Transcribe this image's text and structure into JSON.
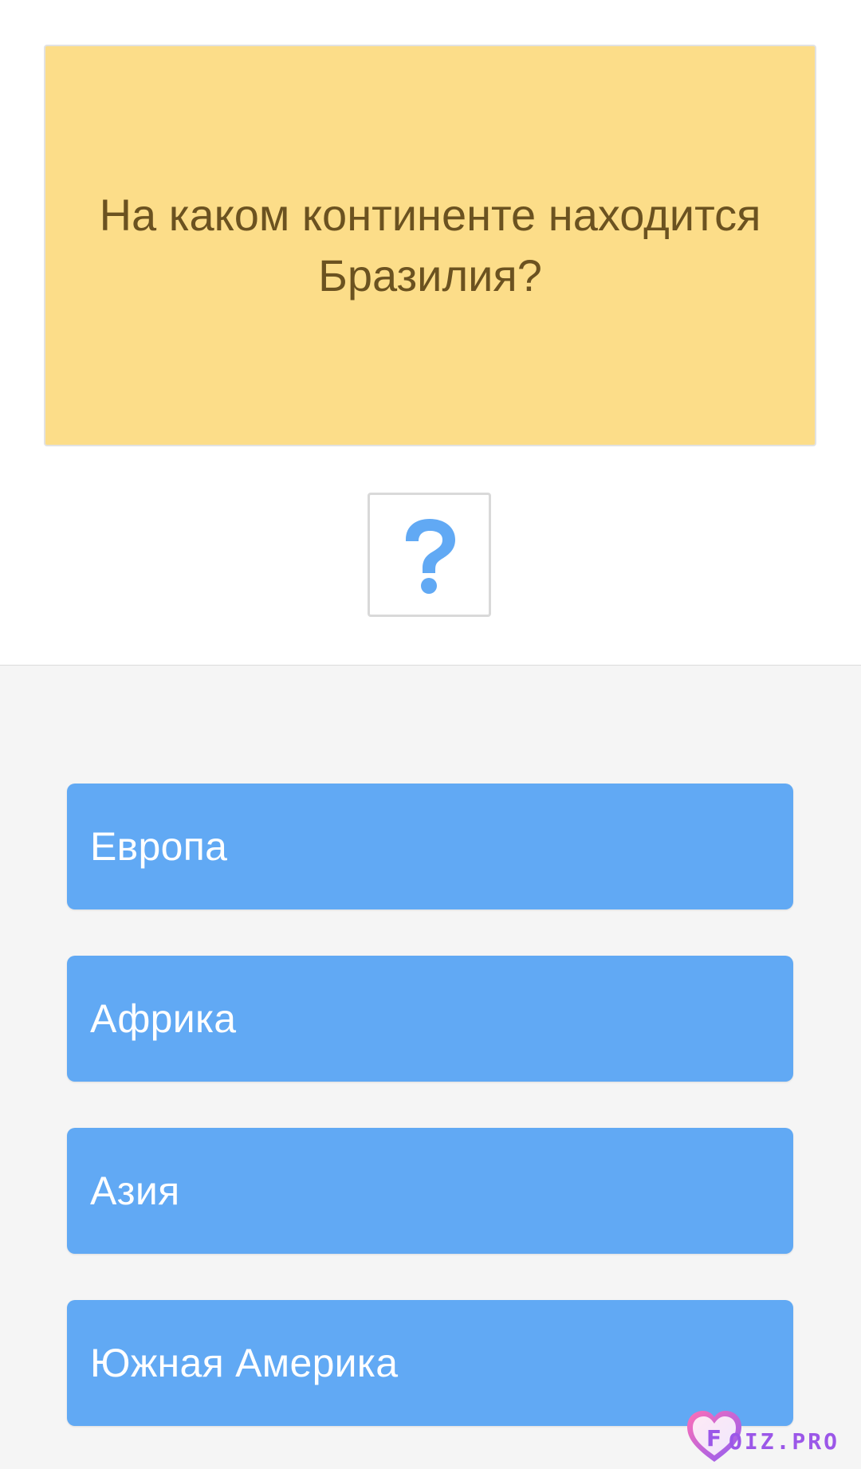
{
  "question": {
    "text": "На каком континенте находится Бразилия?"
  },
  "hint": {
    "icon": "question-mark-icon",
    "color": "#61a9f4"
  },
  "answers": [
    {
      "label": "Европа"
    },
    {
      "label": "Африка"
    },
    {
      "label": "Азия"
    },
    {
      "label": "Южная Америка"
    }
  ],
  "watermark": {
    "text": "OIZ.PRO",
    "logo_letter": "F"
  },
  "colors": {
    "question_card": "#fcdd89",
    "question_text": "#6b5220",
    "answer_button": "#61a9f4",
    "answers_background": "#f5f5f5",
    "watermark": "#9b57e8"
  }
}
